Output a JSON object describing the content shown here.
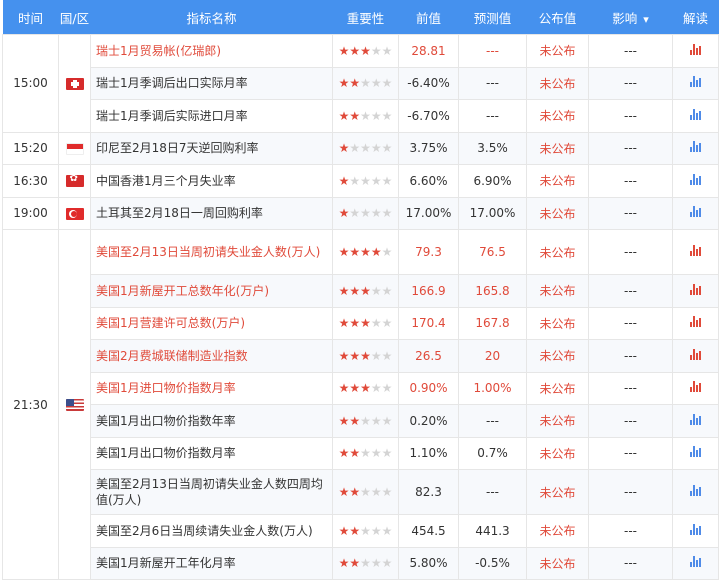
{
  "header": {
    "time": "时间",
    "country": "国/区",
    "name": "指标名称",
    "importance": "重要性",
    "previous": "前值",
    "forecast": "预测值",
    "actual": "公布值",
    "effect": "影响",
    "effect_icon": "chevron-down-icon",
    "interpret": "解读"
  },
  "colors": {
    "header_bg": "#4591ee",
    "highlight_text": "#e04a3a",
    "star_on": "#e04a3a",
    "star_off": "#d4d4d4",
    "chart_blue": "#4f8be8"
  },
  "rows": [
    {
      "time": "15:00",
      "country": "ch",
      "name": "瑞士1月贸易帐(亿瑞郎)",
      "stars": 3,
      "previous": "28.81",
      "forecast": "---",
      "actual": "未公布",
      "effect": "---",
      "highlight": true
    },
    {
      "time": "",
      "country": "",
      "name": "瑞士1月季调后出口实际月率",
      "stars": 2,
      "previous": "-6.40%",
      "forecast": "---",
      "actual": "未公布",
      "effect": "---",
      "highlight": false
    },
    {
      "time": "",
      "country": "",
      "name": "瑞士1月季调后实际进口月率",
      "stars": 2,
      "previous": "-6.70%",
      "forecast": "---",
      "actual": "未公布",
      "effect": "---",
      "highlight": false
    },
    {
      "time": "15:20",
      "country": "id",
      "name": "印尼至2月18日7天逆回购利率",
      "stars": 1,
      "previous": "3.75%",
      "forecast": "3.5%",
      "actual": "未公布",
      "effect": "---",
      "highlight": false
    },
    {
      "time": "16:30",
      "country": "hk",
      "name": "中国香港1月三个月失业率",
      "stars": 1,
      "previous": "6.60%",
      "forecast": "6.90%",
      "actual": "未公布",
      "effect": "---",
      "highlight": false
    },
    {
      "time": "19:00",
      "country": "tr",
      "name": "土耳其至2月18日一周回购利率",
      "stars": 1,
      "previous": "17.00%",
      "forecast": "17.00%",
      "actual": "未公布",
      "effect": "---",
      "highlight": false
    },
    {
      "time": "21:30",
      "country": "us",
      "name": "美国至2月13日当周初请失业金人数(万人)",
      "stars": 4,
      "previous": "79.3",
      "forecast": "76.5",
      "actual": "未公布",
      "effect": "---",
      "highlight": true
    },
    {
      "time": "",
      "country": "",
      "name": "美国1月新屋开工总数年化(万户)",
      "stars": 3,
      "previous": "166.9",
      "forecast": "165.8",
      "actual": "未公布",
      "effect": "---",
      "highlight": true
    },
    {
      "time": "",
      "country": "",
      "name": "美国1月营建许可总数(万户)",
      "stars": 3,
      "previous": "170.4",
      "forecast": "167.8",
      "actual": "未公布",
      "effect": "---",
      "highlight": true
    },
    {
      "time": "",
      "country": "",
      "name": "美国2月费城联储制造业指数",
      "stars": 3,
      "previous": "26.5",
      "forecast": "20",
      "actual": "未公布",
      "effect": "---",
      "highlight": true
    },
    {
      "time": "",
      "country": "",
      "name": "美国1月进口物价指数月率",
      "stars": 3,
      "previous": "0.90%",
      "forecast": "1.00%",
      "actual": "未公布",
      "effect": "---",
      "highlight": true
    },
    {
      "time": "",
      "country": "",
      "name": "美国1月出口物价指数年率",
      "stars": 2,
      "previous": "0.20%",
      "forecast": "---",
      "actual": "未公布",
      "effect": "---",
      "highlight": false
    },
    {
      "time": "",
      "country": "",
      "name": "美国1月出口物价指数月率",
      "stars": 2,
      "previous": "1.10%",
      "forecast": "0.7%",
      "actual": "未公布",
      "effect": "---",
      "highlight": false
    },
    {
      "time": "",
      "country": "",
      "name": "美国至2月13日当周初请失业金人数四周均值(万人)",
      "stars": 2,
      "previous": "82.3",
      "forecast": "---",
      "actual": "未公布",
      "effect": "---",
      "highlight": false
    },
    {
      "time": "",
      "country": "",
      "name": "美国至2月6日当周续请失业金人数(万人)",
      "stars": 2,
      "previous": "454.5",
      "forecast": "441.3",
      "actual": "未公布",
      "effect": "---",
      "highlight": false
    },
    {
      "time": "",
      "country": "",
      "name": "美国1月新屋开工年化月率",
      "stars": 2,
      "previous": "5.80%",
      "forecast": "-0.5%",
      "actual": "未公布",
      "effect": "---",
      "highlight": false
    }
  ]
}
